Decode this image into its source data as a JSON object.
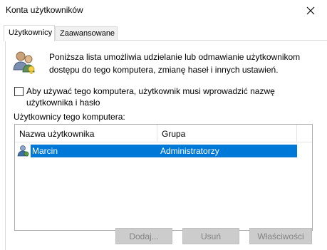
{
  "window": {
    "title": "Konta użytkowników"
  },
  "tabs": [
    {
      "label": "Użytkownicy"
    },
    {
      "label": "Zaawansowane"
    }
  ],
  "info": {
    "text": "Poniższa lista umożliwia udzielanie lub odmawianie użytkownikom dostępu do tego komputera, zmianę haseł i innych ustawień."
  },
  "checkbox": {
    "label": "Aby używać tego komputera, użytkownik musi wprowadzić nazwę użytkownika i hasło",
    "checked": false
  },
  "users": {
    "section_label": "Użytkownicy tego komputera:",
    "columns": [
      "Nazwa użytkownika",
      "Grupa"
    ],
    "rows": [
      {
        "name": "Marcin",
        "group": "Administratorzy",
        "selected": true
      }
    ]
  },
  "buttons": {
    "add": "Dodaj...",
    "remove": "Usuń",
    "properties": "Właściwości"
  },
  "colors": {
    "selection": "#0078d7",
    "disabled_button_bg": "#cccccc",
    "disabled_button_text": "#838383"
  }
}
